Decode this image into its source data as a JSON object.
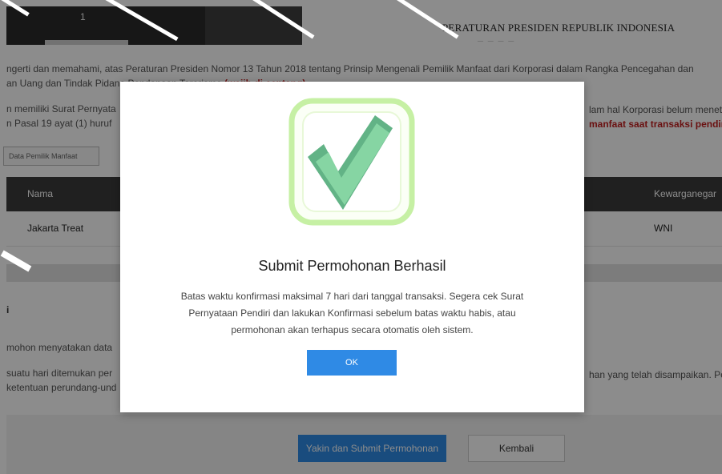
{
  "document": {
    "page_number": "1",
    "title": "PERATURAN PRESIDEN REPUBLIK INDONESIA"
  },
  "background": {
    "para1_line1": "ngerti dan memahami, atas Peraturan Presiden Nomor 13 Tahun 2018 tentang Prinsip Mengenali Pemilik Manfaat dari Korporasi dalam Rangka Pencegahan dan",
    "para1_line2_start": "an Uang dan Tindak Pida",
    "para1_line2_mid": "na Pendanaan Terorisme",
    "para1_required": "(wajib di centang)",
    "para2_line1": "n memiliki Surat Pernyata",
    "para2_line2": "n Pasal 19 ayat (1) huruf",
    "para2_right1": "lam hal Korporasi belum menet",
    "para2_right2_red": "manfaat saat transaksi pendiri",
    "data_button": "Data Pemilik Manfaat",
    "table": {
      "headers": [
        "Nama",
        "Kewarganegar"
      ],
      "row": [
        "Jakarta Treat",
        "WNI"
      ]
    },
    "section_stub": "i",
    "para3_line1": "mohon menyatakan data",
    "para3_line2": "suatu hari ditemukan per",
    "para3_line3": "ketentuan perundang-und",
    "para3_right": "han yang telah disampaikan. Pe",
    "submit_button": "Yakin dan Submit Permohonan",
    "back_button": "Kembali"
  },
  "modal": {
    "icon": "check-icon",
    "title": "Submit Permohonan Berhasil",
    "message_line1": "Batas waktu konfirmasi maksimal 7 hari dari tanggal transaksi. Segera cek Surat",
    "message_line2": "Pernyataan Pendiri dan lakukan Konfirmasi sebelum batas waktu habis, atau",
    "message_line3": "permohonan akan terhapus secara otomatis oleh sistem.",
    "ok_button": "OK"
  },
  "colors": {
    "primary": "#2f8ae5",
    "required_red": "#c21f1f",
    "check_green": "#7fce9a",
    "frame_green": "#c6f0a4"
  }
}
